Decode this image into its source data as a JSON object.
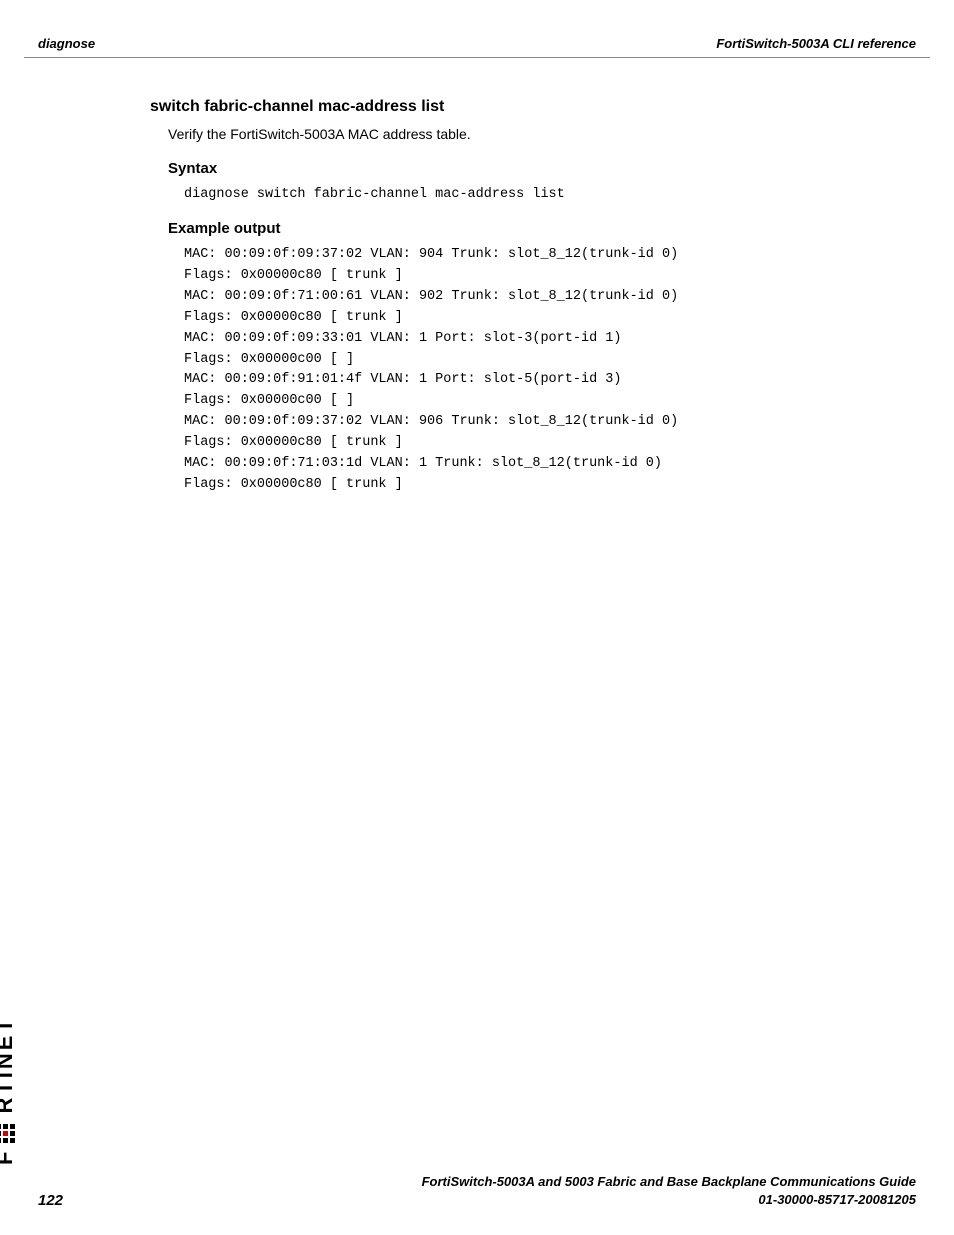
{
  "header": {
    "left": "diagnose",
    "right": "FortiSwitch-5003A CLI reference"
  },
  "section": {
    "title": "switch fabric-channel mac-address list",
    "description": "Verify the FortiSwitch-5003A MAC address table.",
    "syntax_heading": "Syntax",
    "syntax_code": "diagnose switch fabric-channel mac-address list",
    "example_heading": "Example output",
    "example_code": "MAC: 00:09:0f:09:37:02 VLAN: 904 Trunk: slot_8_12(trunk-id 0)\nFlags: 0x00000c80 [ trunk ]\nMAC: 00:09:0f:71:00:61 VLAN: 902 Trunk: slot_8_12(trunk-id 0)\nFlags: 0x00000c80 [ trunk ]\nMAC: 00:09:0f:09:33:01 VLAN: 1 Port: slot-3(port-id 1)\nFlags: 0x00000c00 [ ]\nMAC: 00:09:0f:91:01:4f VLAN: 1 Port: slot-5(port-id 3)\nFlags: 0x00000c00 [ ]\nMAC: 00:09:0f:09:37:02 VLAN: 906 Trunk: slot_8_12(trunk-id 0)\nFlags: 0x00000c80 [ trunk ]\nMAC: 00:09:0f:71:03:1d VLAN: 1 Trunk: slot_8_12(trunk-id 0)\nFlags: 0x00000c80 [ trunk ]"
  },
  "logo": {
    "text": "RTINET",
    "prefix": "F"
  },
  "footer": {
    "page": "122",
    "line1": "FortiSwitch-5003A and 5003   Fabric and Base Backplane Communications Guide",
    "line2": "01-30000-85717-20081205"
  }
}
